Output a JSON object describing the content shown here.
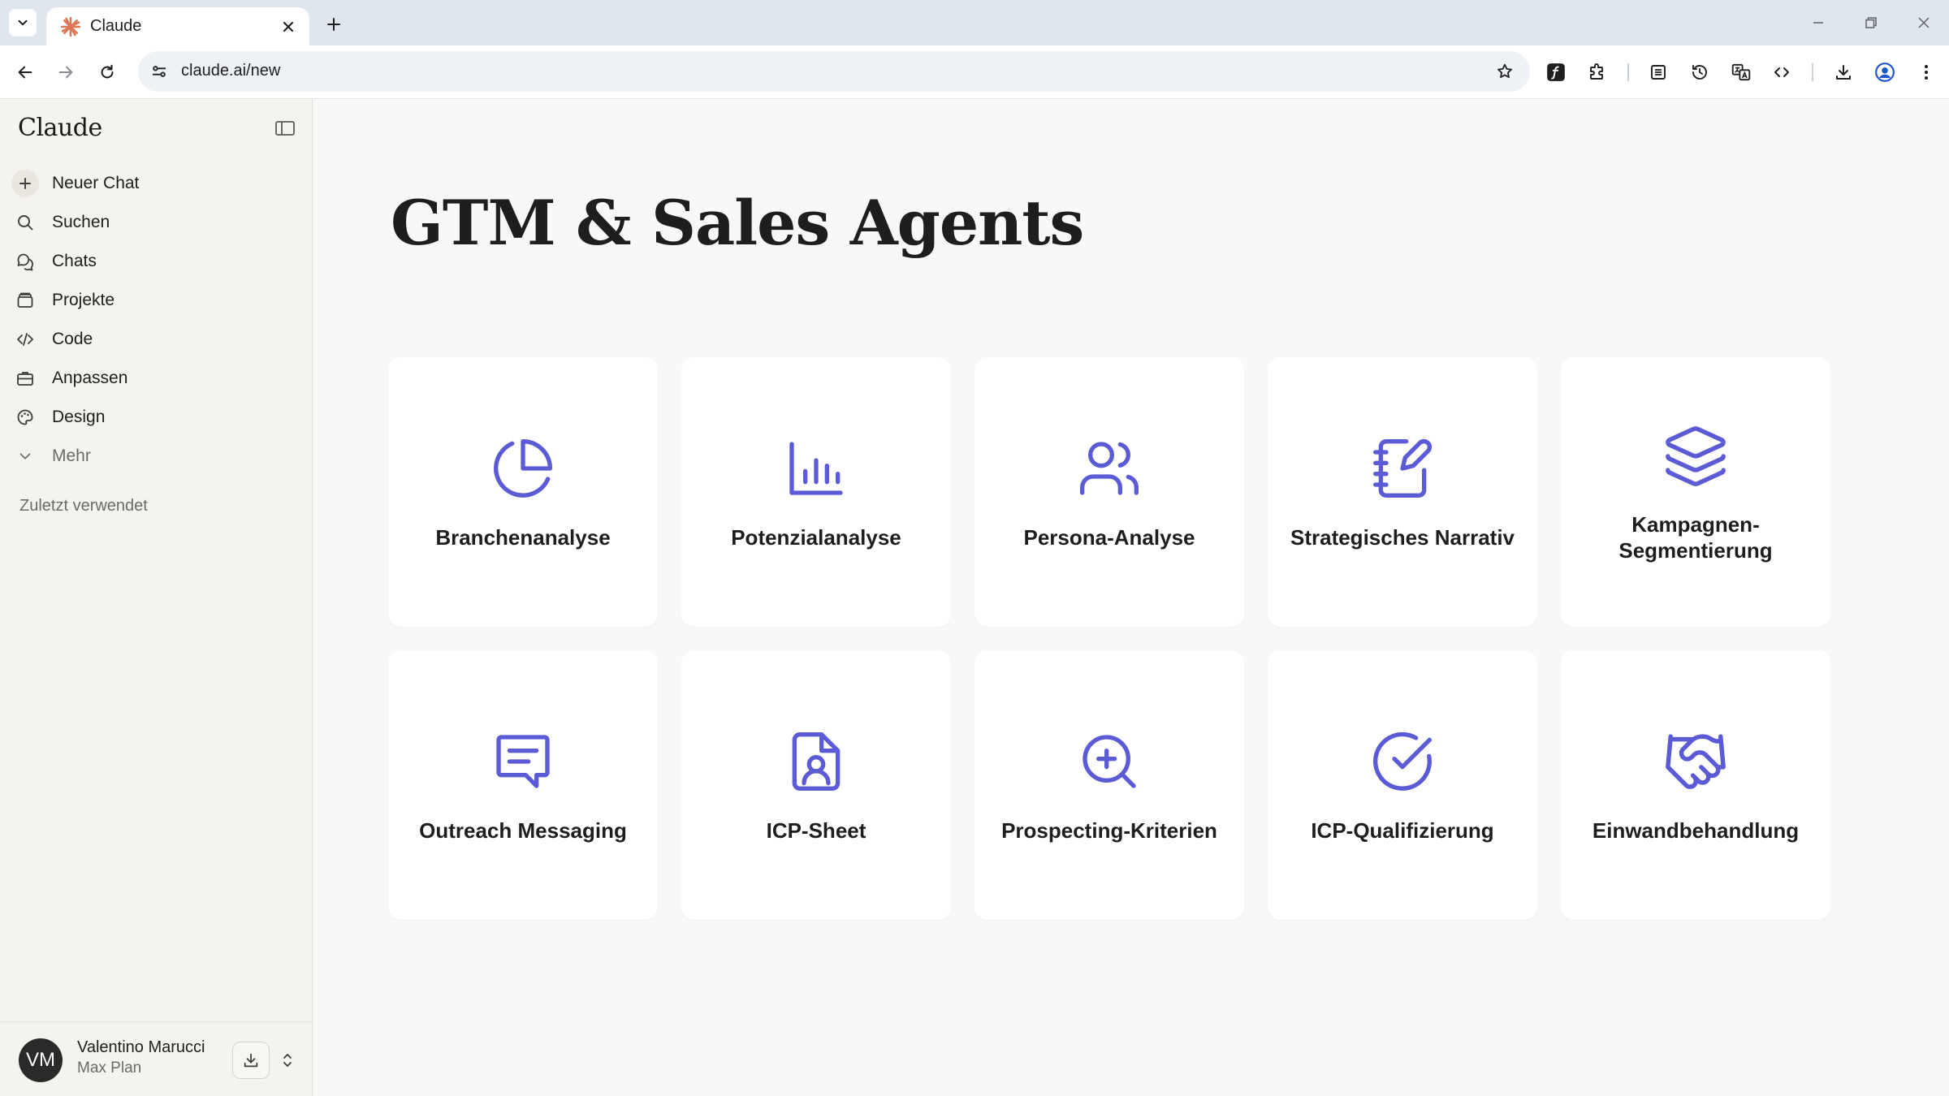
{
  "browser": {
    "tab_title": "Claude",
    "url": "claude.ai/new"
  },
  "sidebar": {
    "brand": "Claude",
    "items": [
      {
        "label": "Neuer Chat",
        "icon": "plus-icon"
      },
      {
        "label": "Suchen",
        "icon": "search-icon"
      },
      {
        "label": "Chats",
        "icon": "chat-bubbles-icon"
      },
      {
        "label": "Projekte",
        "icon": "folder-stack-icon"
      },
      {
        "label": "Code",
        "icon": "code-icon"
      },
      {
        "label": "Anpassen",
        "icon": "briefcase-icon"
      },
      {
        "label": "Design",
        "icon": "palette-icon"
      },
      {
        "label": "Mehr",
        "icon": "chevron-down-icon"
      }
    ],
    "recent_label": "Zuletzt verwendet",
    "user": {
      "initials": "VM",
      "name": "Valentino Marucci",
      "plan": "Max Plan"
    }
  },
  "main": {
    "title": "GTM & Sales Agents",
    "accent_color": "#5b5bd6",
    "cards": [
      {
        "label": "Branchenanalyse",
        "icon": "pie-chart-icon"
      },
      {
        "label": "Potenzialanalyse",
        "icon": "bar-chart-icon"
      },
      {
        "label": "Persona-Analyse",
        "icon": "users-icon"
      },
      {
        "label": "Strategisches Narrativ",
        "icon": "notebook-pen-icon"
      },
      {
        "label": "Kampagnen-Segmentierung",
        "icon": "layers-icon"
      },
      {
        "label": "Outreach Messaging",
        "icon": "message-square-icon"
      },
      {
        "label": "ICP-Sheet",
        "icon": "file-user-icon"
      },
      {
        "label": "Prospecting-Kriterien",
        "icon": "zoom-in-icon"
      },
      {
        "label": "ICP-Qualifizierung",
        "icon": "circle-check-icon"
      },
      {
        "label": "Einwandbehandlung",
        "icon": "handshake-icon"
      }
    ]
  }
}
